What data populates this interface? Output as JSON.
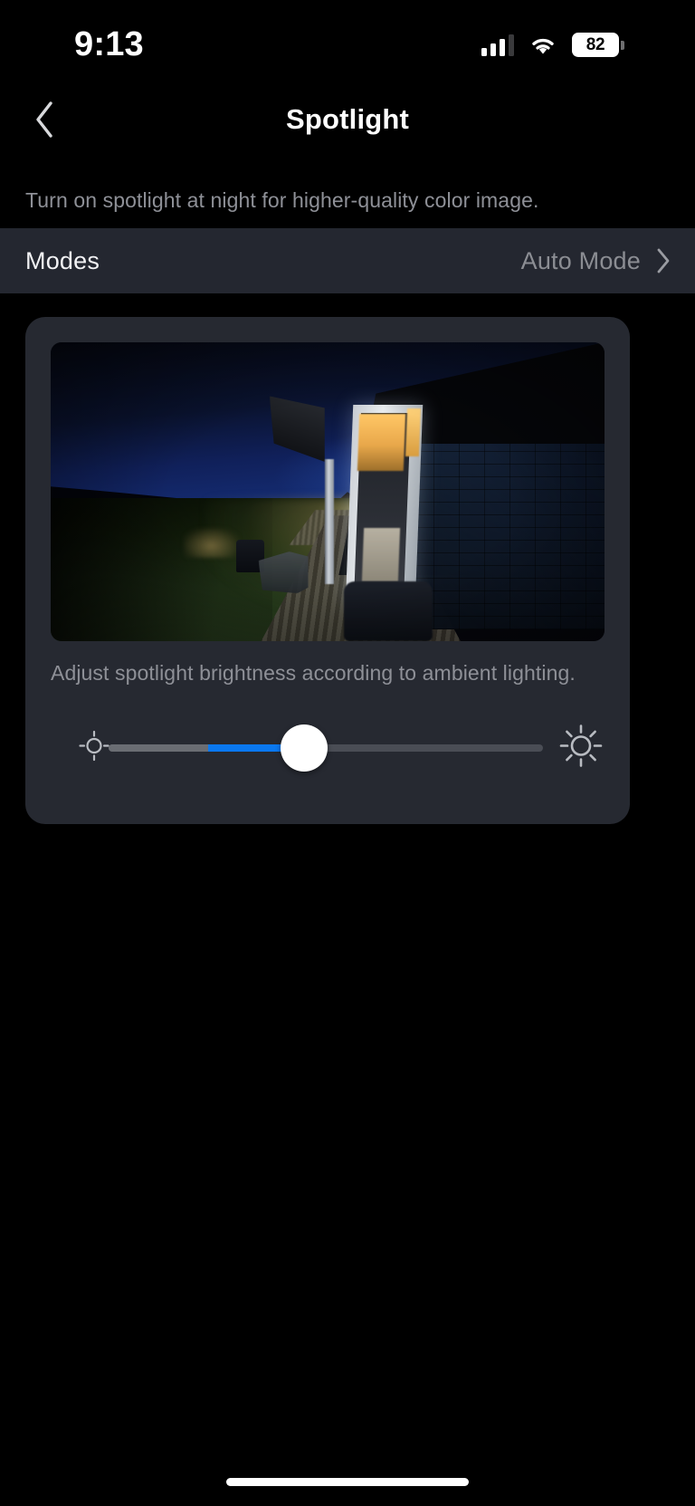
{
  "status_bar": {
    "time": "9:13",
    "cellular_icon": "cellular-bars-icon",
    "wifi_icon": "wifi-icon",
    "battery_percent": "82",
    "battery_icon": "battery-icon"
  },
  "nav": {
    "back_icon": "chevron-left-icon",
    "title": "Spotlight"
  },
  "page_hint": "Turn on spotlight at night for higher-quality color image.",
  "modes_row": {
    "label": "Modes",
    "value": "Auto Mode",
    "chevron_icon": "chevron-right-icon"
  },
  "card": {
    "preview_alt": "night-camera-preview",
    "hint": "Adjust spotlight brightness according to ambient lighting.",
    "slider": {
      "low_icon": "brightness-low-icon",
      "high_icon": "brightness-high-icon",
      "value_percent": 45,
      "min": 0,
      "max": 100,
      "fill_color": "#0a78f0",
      "track_color": "#4a4d55",
      "thumb_color": "#ffffff"
    }
  },
  "home_indicator": "home-indicator",
  "colors": {
    "background": "#000000",
    "row_background": "#242730",
    "card_background": "#262931",
    "primary_text": "#ffffff",
    "secondary_text": "#8e9097",
    "accent": "#0a78f0"
  }
}
